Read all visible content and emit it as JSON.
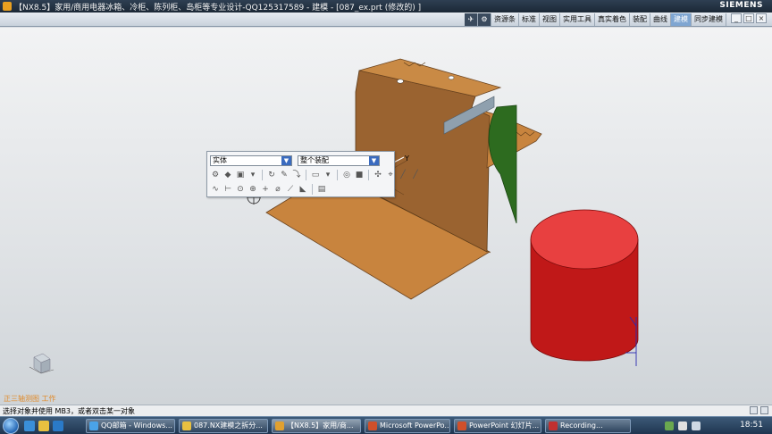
{
  "window": {
    "title": "【NX8.5】家用/商用电器冰箱、冷柜、陈列柜、岛柜等专业设计-QQ125317589 - 建模 - [087_ex.prt  (修改的) ]",
    "brand": "SIEMENS"
  },
  "ribbon": {
    "tabs": [
      {
        "label": "资源条",
        "active": false
      },
      {
        "label": "标准",
        "active": false
      },
      {
        "label": "视图",
        "active": false
      },
      {
        "label": "实用工具",
        "active": false
      },
      {
        "label": "真实着色",
        "active": false
      },
      {
        "label": "装配",
        "active": false
      },
      {
        "label": "曲线",
        "active": false
      },
      {
        "label": "建模",
        "active": true
      },
      {
        "label": "同步建模",
        "active": false
      }
    ],
    "icons": [
      "bird-icon",
      "gear-icon"
    ],
    "window_controls": [
      "_",
      "□",
      "×"
    ]
  },
  "selection_toolbar": {
    "type_filter": "实体",
    "scope_filter": "整个装配"
  },
  "viewport": {
    "view_label": "正三轴测图 工作",
    "axis_label": "Y",
    "colors": {
      "sheet_metal": "#c8843e",
      "sheet_metal_dark": "#8a5a2a",
      "cylinder_top": "#e84040",
      "cylinder_side": "#c01818",
      "green_part": "#2d6b1f",
      "gray_plate": "#8fa0ae"
    }
  },
  "statusbar": {
    "prompt": "选择对象并使用 MB3，或者双击某一对象"
  },
  "taskbar": {
    "tasks": [
      {
        "label": "QQ邮箱 - Windows...",
        "active": false,
        "color": "#4aa3e8"
      },
      {
        "label": "087.NX建模之拆分...",
        "active": false,
        "color": "#e8c040"
      },
      {
        "label": "【NX8.5】家用/商...",
        "active": true,
        "color": "#e0a030"
      },
      {
        "label": "Microsoft PowerPo...",
        "active": false,
        "color": "#d0502a"
      },
      {
        "label": "PowerPoint 幻灯片...",
        "active": false,
        "color": "#d0502a"
      },
      {
        "label": "Recording...",
        "active": false,
        "color": "#c03030"
      }
    ],
    "clock": "18:51"
  }
}
